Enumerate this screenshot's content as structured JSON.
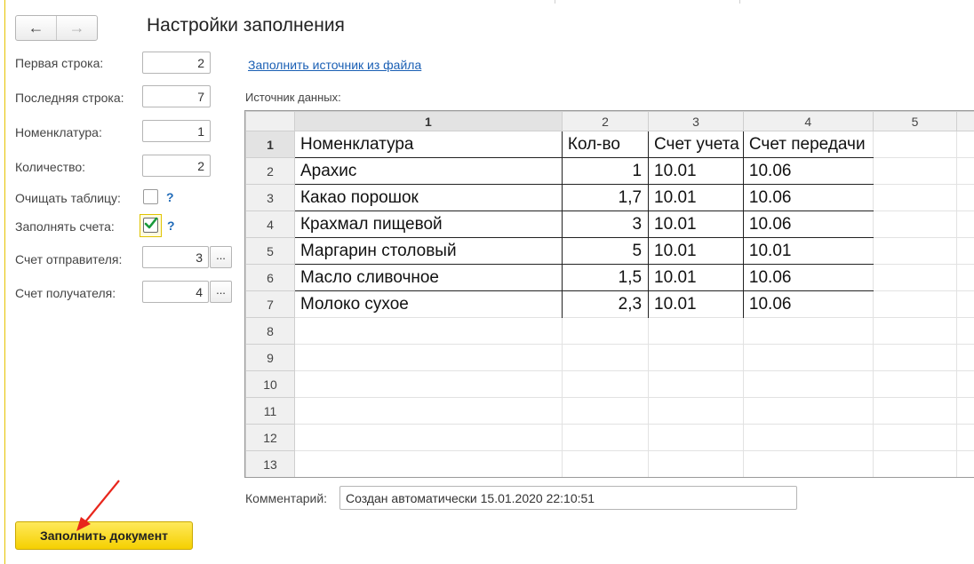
{
  "window": {
    "title": "Настройки заполнения"
  },
  "nav": {
    "back_icon": "←",
    "forward_icon": "→"
  },
  "settings": {
    "first_row_label": "Первая строка:",
    "first_row_value": "2",
    "last_row_label": "Последняя строка:",
    "last_row_value": "7",
    "nomenclature_label": "Номенклатура:",
    "nomenclature_value": "1",
    "quantity_label": "Количество:",
    "quantity_value": "2",
    "clear_table_label": "Очищать таблицу:",
    "fill_accounts_label": "Заполнять счета:",
    "sender_account_label": "Счет отправителя:",
    "sender_account_value": "3",
    "receiver_account_label": "Счет получателя:",
    "receiver_account_value": "4",
    "help_mark": "?",
    "select_button": "..."
  },
  "link": {
    "fill_from_file": "Заполнить источник из файла"
  },
  "source": {
    "label": "Источник данных:",
    "col_headers": [
      "1",
      "2",
      "3",
      "4",
      "5"
    ],
    "row_headers": [
      "1",
      "2",
      "3",
      "4",
      "5",
      "6",
      "7",
      "8",
      "9",
      "10",
      "11",
      "12",
      "13"
    ],
    "rows": [
      [
        "Номенклатура",
        "Кол-во",
        "Счет учета",
        "Счет передачи"
      ],
      [
        "Арахис",
        "1",
        "10.01",
        "10.06"
      ],
      [
        "Какао порошок",
        "1,7",
        "10.01",
        "10.06"
      ],
      [
        "Крахмал пищевой",
        "3",
        "10.01",
        "10.06"
      ],
      [
        "Маргарин столовый",
        "5",
        "10.01",
        "10.01"
      ],
      [
        "Масло сливочное",
        "1,5",
        "10.01",
        "10.06"
      ],
      [
        "Молоко сухое",
        "2,3",
        "10.01",
        "10.06"
      ]
    ]
  },
  "comment": {
    "label": "Комментарий:",
    "value": "Создан автоматически 15.01.2020 22:10:51"
  },
  "actions": {
    "fill_document": "Заполнить документ"
  },
  "colors": {
    "accent": "#f5d000",
    "link": "#1a5fb4",
    "annotation_arrow": "#e8261c"
  }
}
